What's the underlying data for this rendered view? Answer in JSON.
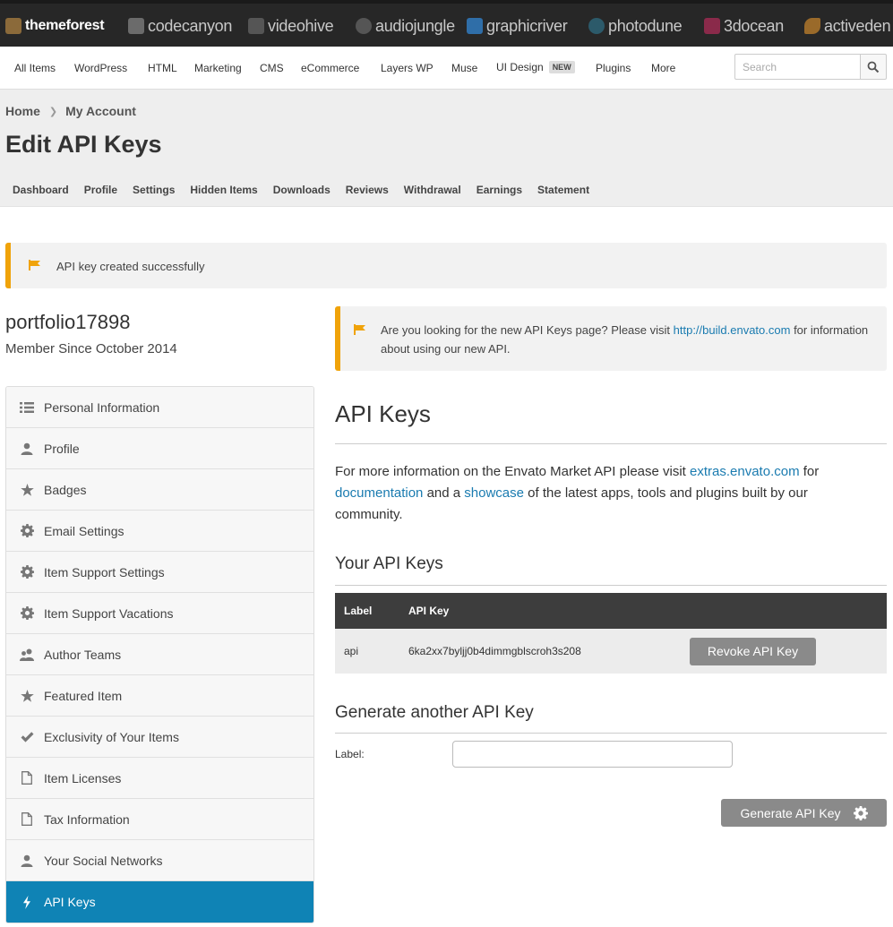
{
  "markets": [
    {
      "label": "themeforest",
      "color": "#ffffff"
    },
    {
      "label": "codecanyon",
      "color": "#c8c8c8"
    },
    {
      "label": "videohive",
      "color": "#c8c8c8"
    },
    {
      "label": "audiojungle",
      "color": "#c8c8c8"
    },
    {
      "label": "graphicriver",
      "color": "#c8c8c8"
    },
    {
      "label": "photodune",
      "color": "#c8c8c8"
    },
    {
      "label": "3docean",
      "color": "#c8c8c8"
    },
    {
      "label": "activeden",
      "color": "#c8c8c8"
    }
  ],
  "categories": {
    "items": [
      "All Items",
      "WordPress",
      "HTML",
      "Marketing",
      "CMS",
      "eCommerce",
      "Layers WP",
      "Muse",
      "UI Design",
      "Plugins",
      "More"
    ],
    "new_badge": "NEW"
  },
  "search": {
    "placeholder": "Search",
    "icon": "search-icon"
  },
  "breadcrumb": {
    "home": "Home",
    "current": "My Account"
  },
  "page": {
    "title": "Edit API Keys"
  },
  "account_tabs": [
    "Dashboard",
    "Profile",
    "Settings",
    "Hidden Items",
    "Downloads",
    "Reviews",
    "Withdrawal",
    "Earnings",
    "Statement"
  ],
  "alerts": {
    "success": "API key created successfully",
    "info_prefix": "Are you looking for the new API Keys page? Please visit ",
    "info_link": "http://build.envato.com",
    "info_suffix": " for information about using our new API.",
    "accent": "#f0a30a"
  },
  "user": {
    "name": "portfolio17898",
    "member_since": "Member Since October 2014"
  },
  "sidebar": {
    "active_color": "#0f83b5",
    "items": [
      {
        "label": "Personal Information",
        "icon": "list-icon"
      },
      {
        "label": "Profile",
        "icon": "user-icon"
      },
      {
        "label": "Badges",
        "icon": "star-icon"
      },
      {
        "label": "Email Settings",
        "icon": "gear-icon"
      },
      {
        "label": "Item Support Settings",
        "icon": "gear-icon"
      },
      {
        "label": "Item Support Vacations",
        "icon": "gear-icon"
      },
      {
        "label": "Author Teams",
        "icon": "users-icon"
      },
      {
        "label": "Featured Item",
        "icon": "star-icon"
      },
      {
        "label": "Exclusivity of Your Items",
        "icon": "check-icon"
      },
      {
        "label": "Item Licenses",
        "icon": "file-icon"
      },
      {
        "label": "Tax Information",
        "icon": "file-icon"
      },
      {
        "label": "Your Social Networks",
        "icon": "user-icon"
      },
      {
        "label": "API Keys",
        "icon": "bolt-icon"
      }
    ]
  },
  "main": {
    "title": "API Keys",
    "para_1": "For more information on the Envato Market API please visit ",
    "link_extras": "extras.envato.com",
    "para_2": " for ",
    "link_docs": "documentation",
    "para_3": " and a ",
    "link_showcase": "showcase",
    "para_4": " of the latest apps, tools and plugins built by our community.",
    "your_keys_title": "Your API Keys",
    "table": {
      "headers": [
        "Label",
        "API Key"
      ],
      "rows": [
        {
          "label": "api",
          "key": "6ka2xx7byljj0b4dimmgblscroh3s208",
          "action": "Revoke API Key"
        }
      ]
    },
    "generate_title": "Generate another API Key",
    "label_field": "Label:",
    "label_value": "",
    "generate_button": "Generate API Key"
  }
}
